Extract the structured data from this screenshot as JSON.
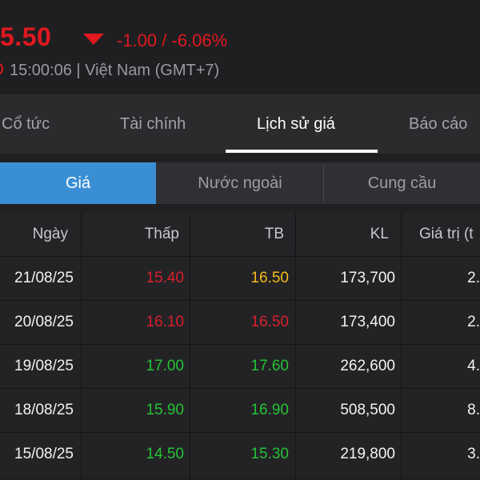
{
  "header": {
    "price": "5.50",
    "change": "-1.00 / -6.06%",
    "time": "15:00:06 | Việt Nam (GMT+7)",
    "colors": {
      "down": "#e0181f",
      "muted": "#9a9aa0"
    }
  },
  "tabs": [
    {
      "label": "Cổ tức",
      "active": false
    },
    {
      "label": "Tài chính",
      "active": false
    },
    {
      "label": "Lịch sử giá",
      "active": true
    },
    {
      "label": "Báo cáo",
      "active": false
    }
  ],
  "segments": [
    {
      "label": "Giá",
      "active": true
    },
    {
      "label": "Nước ngoài",
      "active": false
    },
    {
      "label": "Cung cầu",
      "active": false
    }
  ],
  "table": {
    "headers": [
      "Ngày",
      "Thấp",
      "TB",
      "KL",
      "Giá trị (t"
    ],
    "rows": [
      {
        "date": "21/08/25",
        "low": "15.40",
        "low_color": "#d9202a",
        "avg": "16.50",
        "avg_color": "#f4b91a",
        "vol": "173,700",
        "val": "2."
      },
      {
        "date": "20/08/25",
        "low": "16.10",
        "low_color": "#d9202a",
        "avg": "16.50",
        "avg_color": "#d9202a",
        "vol": "173,400",
        "val": "2."
      },
      {
        "date": "19/08/25",
        "low": "17.00",
        "low_color": "#25c233",
        "avg": "17.60",
        "avg_color": "#25c233",
        "vol": "262,600",
        "val": "4."
      },
      {
        "date": "18/08/25",
        "low": "15.90",
        "low_color": "#25c233",
        "avg": "16.90",
        "avg_color": "#25c233",
        "vol": "508,500",
        "val": "8."
      },
      {
        "date": "15/08/25",
        "low": "14.50",
        "low_color": "#25c233",
        "avg": "15.30",
        "avg_color": "#25c233",
        "vol": "219,800",
        "val": "3."
      }
    ]
  }
}
